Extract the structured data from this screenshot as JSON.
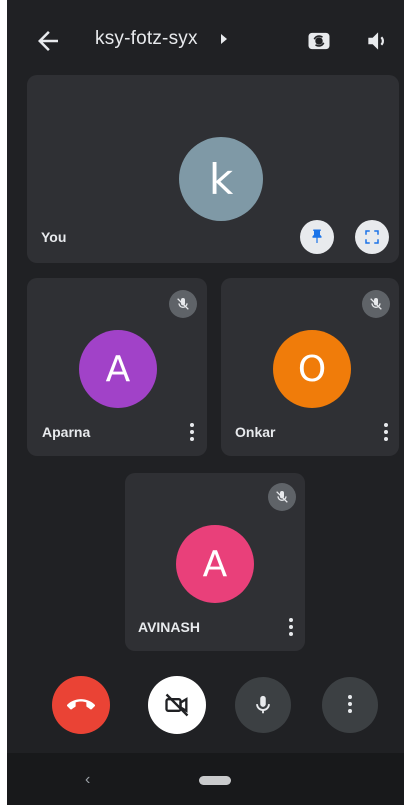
{
  "header": {
    "meeting_code": "ksy-fotz-syx"
  },
  "tiles": {
    "you": {
      "initial": "k",
      "name": "You",
      "avatar_color": "#7f99a6"
    },
    "aparna": {
      "initial": "A",
      "name": "Aparna",
      "avatar_color": "#a142c8"
    },
    "onkar": {
      "initial": "O",
      "name": "Onkar",
      "avatar_color": "#f07c0a"
    },
    "avinash": {
      "initial": "A",
      "name": "AVINASH",
      "avatar_color": "#e9407a"
    }
  },
  "controls": {
    "end_call_color": "#ea4335",
    "icons": [
      "end-call-icon",
      "camera-off-icon",
      "microphone-icon",
      "more-options-icon"
    ]
  },
  "navigation": {
    "back_glyph": "‹"
  }
}
